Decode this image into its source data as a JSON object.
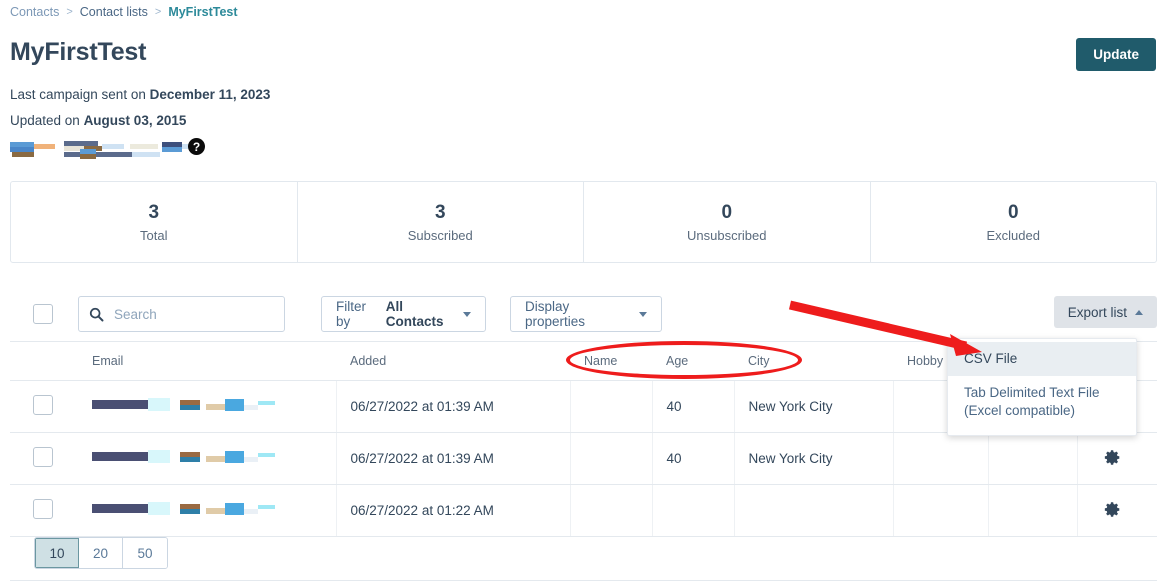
{
  "breadcrumb": {
    "items": [
      {
        "label": "Contacts",
        "current": false
      },
      {
        "label": "Contact lists",
        "current": false
      },
      {
        "label": "MyFirstTest",
        "current": true
      }
    ],
    "separator": ">"
  },
  "header": {
    "title": "MyFirstTest",
    "update_label": "Update"
  },
  "meta": {
    "last_campaign_prefix": "Last campaign sent on ",
    "last_campaign_date": "December 11, 2023",
    "updated_prefix": "Updated on ",
    "updated_date": "August 03, 2015",
    "help_icon_glyph": "?"
  },
  "stats": [
    {
      "value": "3",
      "label": "Total"
    },
    {
      "value": "3",
      "label": "Subscribed"
    },
    {
      "value": "0",
      "label": "Unsubscribed"
    },
    {
      "value": "0",
      "label": "Excluded"
    }
  ],
  "toolbar": {
    "search_placeholder": "Search",
    "search_value": "",
    "filter_prefix": "Filter by ",
    "filter_value": "All Contacts",
    "display_properties_label": "Display properties",
    "export_label": "Export list"
  },
  "export_menu": {
    "items": [
      {
        "label": "CSV File",
        "active": true
      },
      {
        "label": "Tab Delimited Text File (Excel compatible)",
        "active": false
      }
    ]
  },
  "table": {
    "columns": [
      "",
      "Email",
      "Added",
      "Name",
      "Age",
      "City",
      "Hobby",
      "",
      ""
    ],
    "rows": [
      {
        "email": "",
        "added": "06/27/2022 at 01:39 AM",
        "name": "",
        "age": "40",
        "city": "New York City",
        "hobby": "",
        "extra": "",
        "gear": false
      },
      {
        "email": "",
        "added": "06/27/2022 at 01:39 AM",
        "name": "",
        "age": "40",
        "city": "New York City",
        "hobby": "",
        "extra": "",
        "gear": true
      },
      {
        "email": "",
        "added": "06/27/2022 at 01:22 AM",
        "name": "",
        "age": "",
        "city": "",
        "hobby": "",
        "extra": "",
        "gear": true
      }
    ]
  },
  "pagination": {
    "options": [
      "10",
      "20",
      "50"
    ],
    "selected": "10"
  },
  "annotations": {
    "oval_color": "#ee1c1c",
    "arrow_color": "#ee1c1c"
  },
  "colors": {
    "primary_button": "#205b6b",
    "accent_link": "#2d8a9a",
    "text": "#33475b",
    "muted": "#7c98b6",
    "border": "#cbd6e2",
    "export_button_bg": "#dfe3e8",
    "pagination_active": "#cfe0e4"
  }
}
